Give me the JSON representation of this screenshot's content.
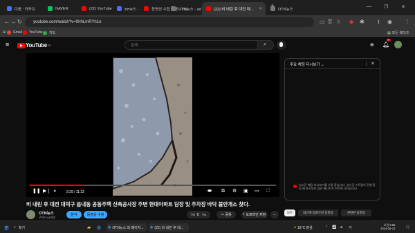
{
  "browser": {
    "tabs": [
      {
        "label": "다음 : 카카오",
        "fav_color": "#4c6ef5"
      },
      {
        "label": "NAVER",
        "fav_color": "#03c75a"
      },
      {
        "label": "(22) YouTube",
        "fav_color": "#ff0000"
      },
      {
        "label": "ztmk스 - Daum 카페",
        "fav_color": "#4c6ef5"
      },
      {
        "label": "동영상 수집 활용 - YouTube S...",
        "fav_color": "#ff0000"
      },
      {
        "label": "OTN뉴스 - admin",
        "fav_color": "#777777"
      },
      {
        "label": "(22) 비 내린 후 대전 대...",
        "fav_color": "#ff0000"
      },
      {
        "label": "OTN뉴스",
        "fav_color": "#777777"
      }
    ],
    "url": "youtube.com/watch?v=llHhLmRYh1o",
    "bookmarks": [
      {
        "label": "Gmail",
        "color": "#ea4335"
      },
      {
        "label": "YouTube",
        "color": "#ff0000"
      },
      {
        "label": "지도",
        "color": "#34a853"
      }
    ],
    "bookmarks_right": "모든 북마크"
  },
  "youtube": {
    "logo_text": "YouTube",
    "logo_sup": "KR",
    "search_placeholder": "검색",
    "notification_count": "9+"
  },
  "player": {
    "time": "2:29 / 11:32",
    "progress": 0.22
  },
  "video": {
    "title": "비 내린 후 대전 대덕구 읍내동 공동주택 신축공사장 주변 현대아파트 담장 및 주차장 바닥 불안개소 찾다.",
    "channel": "OTN뉴스",
    "subscribers": "구독자 64천명",
    "analytics_label": "분석",
    "edit_label": "동영상 수정",
    "like_count": "0",
    "share_label": "공유",
    "download_label": "오프라인 저장"
  },
  "chat": {
    "header": "주요 채팅 다시보기",
    "message": "실시간 채팅 다시보기를 사용 중입니다. 실시간 스트림이 진행 중일 때 표시되지 않은 메시지가 여기에 나타납니다."
  },
  "chips": [
    "모두",
    "최근에 업로드된 동영상",
    "관련된 동영상"
  ],
  "taskbar": {
    "search_label": "찾기",
    "apps": [
      "OTN뉴스 외 페이지...",
      "(22) 비 내린 후 대..."
    ],
    "weather": "18°C 맑음",
    "time": "오전 9:56",
    "date": "2024-05-14"
  }
}
